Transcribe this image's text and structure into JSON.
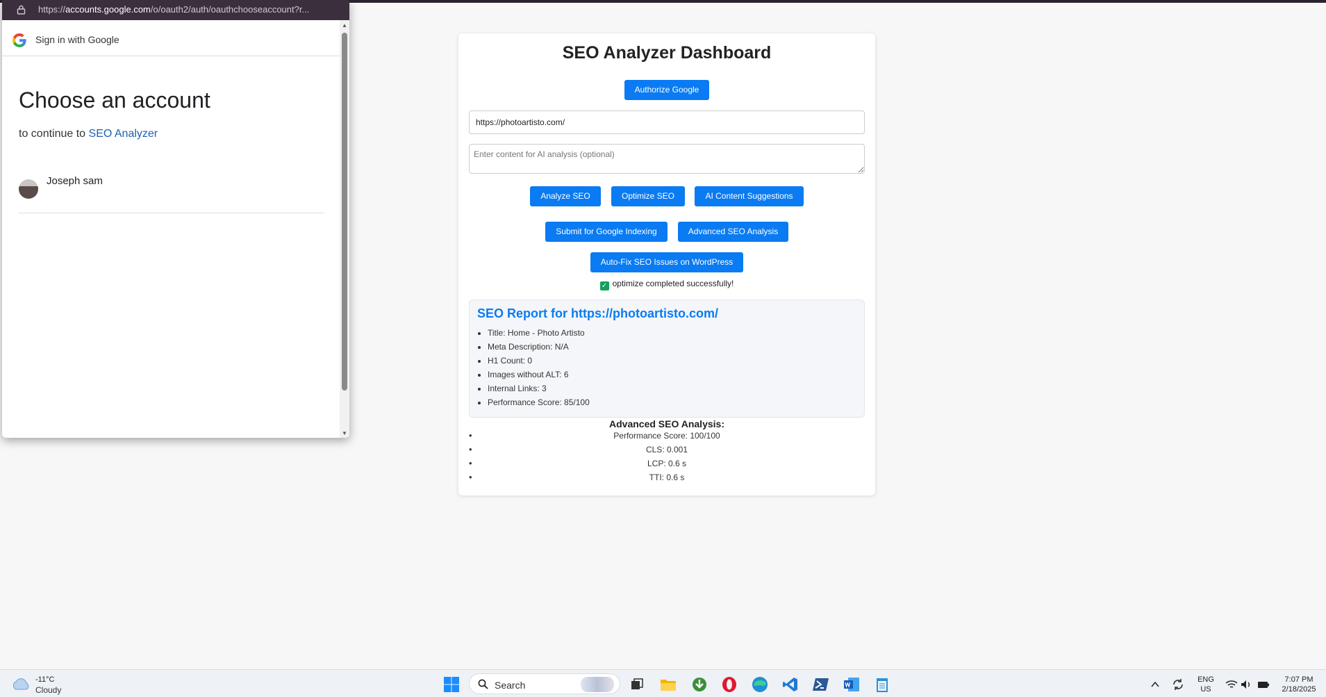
{
  "popup": {
    "url_prefix": "https://",
    "url_host": "accounts.google.com",
    "url_path": "/o/oauth2/auth/oauthchooseaccount?r...",
    "header_label": "Sign in with Google",
    "heading": "Choose an account",
    "continue_text": "to continue to",
    "continue_app": "SEO Analyzer",
    "account_name": "Joseph sam"
  },
  "dashboard": {
    "title": "SEO Analyzer Dashboard",
    "authorize_label": "Authorize Google",
    "url_value": "https://photoartisto.com/",
    "content_placeholder": "Enter content for AI analysis (optional)",
    "buttons": {
      "analyze": "Analyze SEO",
      "optimize": "Optimize SEO",
      "ai_suggestions": "AI Content Suggestions",
      "submit_indexing": "Submit for Google Indexing",
      "advanced": "Advanced SEO Analysis",
      "auto_fix": "Auto-Fix SEO Issues on WordPress"
    },
    "status_message": "optimize completed successfully!",
    "report": {
      "heading": "SEO Report for https://photoartisto.com/",
      "items": [
        "Title: Home - Photo Artisto",
        "Meta Description: N/A",
        "H1 Count: 0",
        "Images without ALT: 6",
        "Internal Links: 3",
        "Performance Score: 85/100"
      ]
    },
    "advanced": {
      "heading": "Advanced SEO Analysis:",
      "items": [
        "Performance Score: 100/100",
        "CLS: 0.001",
        "LCP: 0.6 s",
        "TTI: 0.6 s"
      ]
    }
  },
  "taskbar": {
    "temperature": "-11°C",
    "condition": "Cloudy",
    "search_placeholder": "Search",
    "language_top": "ENG",
    "language_bottom": "US",
    "time": "7:07 PM",
    "date": "2/18/2025"
  },
  "colors": {
    "primary": "#0a7bf2",
    "success": "#12a05c",
    "popup_bar": "#3c2f3d",
    "link": "#1a5fb4"
  }
}
